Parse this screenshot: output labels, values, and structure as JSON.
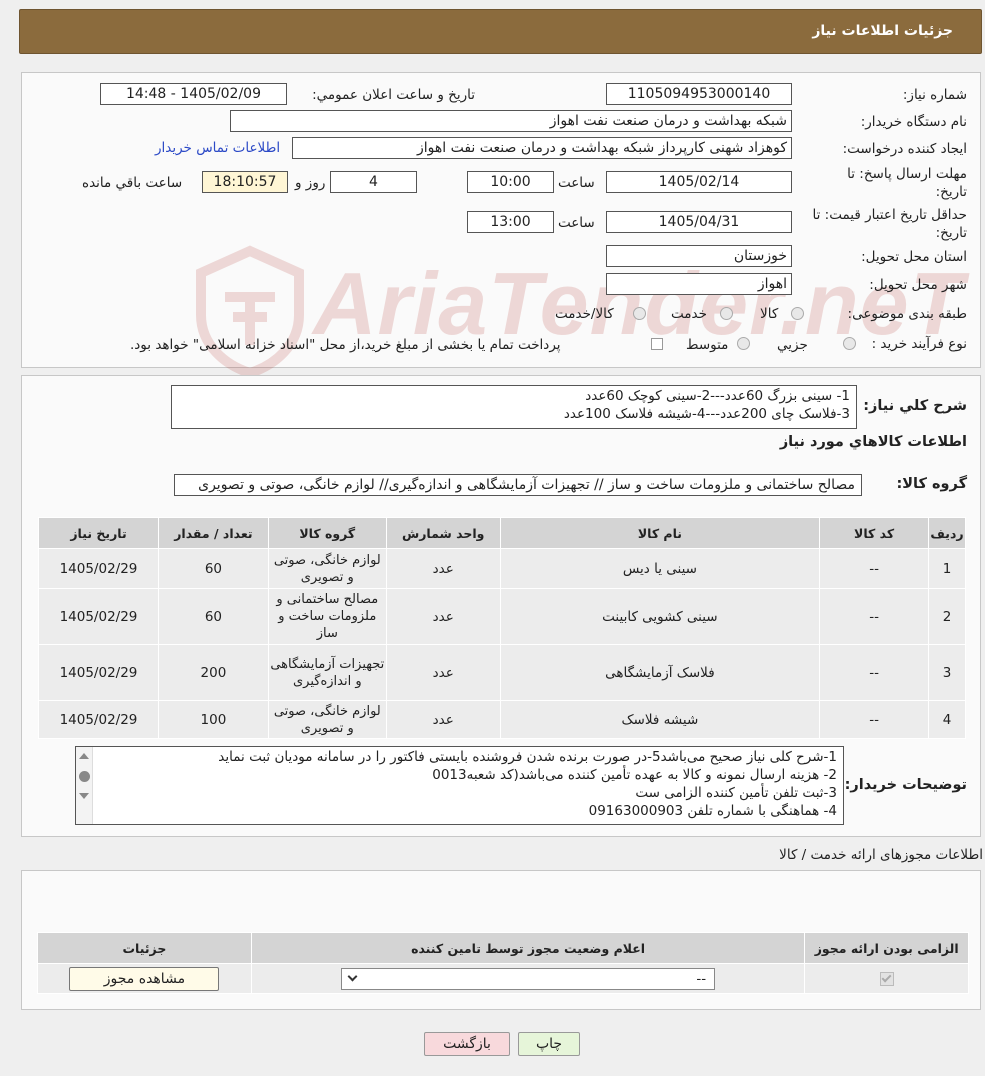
{
  "header": {
    "title": "جزئیات اطلاعات نیاز"
  },
  "form": {
    "need_number_label": "شماره نیاز:",
    "need_number": "1105094953000140",
    "announce_label": "تاریخ و ساعت اعلان عمومي:",
    "announce_value": "1405/02/09 - 14:48",
    "buyer_org_label": "نام دستگاه خریدار:",
    "buyer_org": "شبکه بهداشت و درمان صنعت نفت اهواز",
    "creator_label": "ایجاد کننده درخواست:",
    "creator": "کوهزاد شهنی کارپرداز شبکه بهداشت و درمان صنعت نفت اهواز",
    "contact_link": "اطلاعات تماس خریدار",
    "deadline_label": "مهلت ارسال پاسخ: تا تاریخ:",
    "deadline_date": "1405/02/14",
    "time_label": "ساعت",
    "deadline_time": "10:00",
    "days": "4",
    "days_label": "روز و",
    "remaining_time": "18:10:57",
    "remaining_label": "ساعت باقي مانده",
    "validity_label": "حداقل تاریخ اعتبار قیمت: تا تاریخ:",
    "validity_date": "1405/04/31",
    "validity_time": "13:00",
    "province_label": "استان محل تحویل:",
    "province": "خوزستان",
    "city_label": "شهر محل تحویل:",
    "city": "اهواز",
    "category_label": "طبقه بندی موضوعی:",
    "category_options": [
      "کالا",
      "خدمت",
      "کالا/خدمت"
    ],
    "process_label": "نوع فرآیند خرید :",
    "process_options": [
      "جزیي",
      "متوسط"
    ],
    "process_note": "پرداخت تمام یا بخشی از مبلغ خرید،از محل \"اسناد خزانه اسلامی\" خواهد بود."
  },
  "summary": {
    "label": "شرح کلي نياز:",
    "lines": [
      "1- سینی بزرگ 60عدد---2-سینی کوچک 60عدد",
      "3-فلاسک چای 200عدد---4-شیشه فلاسک 100عدد"
    ],
    "goods_info_title": "اطلاعات کالاهاي مورد نياز",
    "goods_group_label": "گروه کالا:",
    "goods_group": "مصالح ساختمانی و ملزومات ساخت و ساز // تجهیزات آزمایشگاهی و اندازه‌گیری// لوازم خانگی، صوتی و تصویری"
  },
  "items_table": {
    "headers": [
      "رديف",
      "کد کالا",
      "نام کالا",
      "واحد شمارش",
      "گروه کالا",
      "تعداد / مقدار",
      "تاریخ نیاز"
    ],
    "rows": [
      {
        "idx": "1",
        "code": "--",
        "name": "سینی یا دیس",
        "unit": "عدد",
        "group": "لوازم خانگی، صوتی و تصویری",
        "qty": "60",
        "date": "1405/02/29"
      },
      {
        "idx": "2",
        "code": "--",
        "name": "سینی کشویی کابینت",
        "unit": "عدد",
        "group": "مصالح ساختمانی و ملزومات ساخت و ساز",
        "qty": "60",
        "date": "1405/02/29"
      },
      {
        "idx": "3",
        "code": "--",
        "name": "فلاسک آزمایشگاهی",
        "unit": "عدد",
        "group": "تجهیزات آزمایشگاهی و اندازه‌گیری",
        "qty": "200",
        "date": "1405/02/29"
      },
      {
        "idx": "4",
        "code": "--",
        "name": "شیشه فلاسک",
        "unit": "عدد",
        "group": "لوازم خانگی، صوتی و تصویری",
        "qty": "100",
        "date": "1405/02/29"
      }
    ]
  },
  "buyer_notes": {
    "label": "توضیحات خریدار:",
    "lines": [
      "1-شرح کلی نیاز صحیح می‌باشد5-در صورت برنده شدن فروشنده بایستی فاکتور را در سامانه مودیان ثبت نماید",
      "2- هزینه ارسال نمونه و کالا به عهده تأمین کننده می‌باشد(کد شعبه0013",
      "3-ثبت تلفن تأمین کننده الزامی ست",
      "4- هماهنگی با شماره تلفن 09163000903"
    ]
  },
  "licenses": {
    "title": "اطلاعات مجوزهای ارائه خدمت / کالا",
    "headers": [
      "الزامی بودن ارائه مجوز",
      "اعلام وضعیت مجوز توسط تامین کننده",
      "جزئیات"
    ],
    "select_value": "--",
    "view_button": "مشاهده مجوز"
  },
  "footer": {
    "print_button": "چاپ",
    "back_button": "بازگشت"
  },
  "watermark": {
    "text": "AriaTender.neT"
  },
  "colors": {
    "header_bg": "#8b6b3d",
    "link": "#2b49c6",
    "back_button": "#f8d9dc",
    "print_button": "#e6f5d9"
  }
}
